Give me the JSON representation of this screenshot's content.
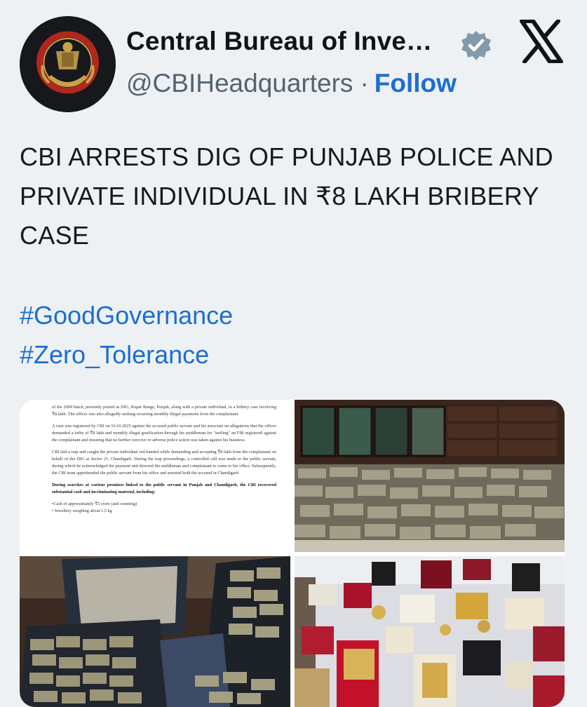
{
  "account": {
    "name": "Central Bureau of Inve…",
    "handle": "@CBIHeadquarters",
    "separator": "·",
    "follow_label": "Follow",
    "avatar_icon": "cbi-emblem-avatar",
    "verified_icon": "verified-badge-icon",
    "platform_icon": "x-logo-icon"
  },
  "tweet": {
    "text": "CBI ARRESTS DIG OF PUNJAB POLICE AND PRIVATE INDIVIDUAL IN ₹8 LAKH BRIBERY CASE",
    "hashtags": [
      "#GoodGovernance",
      "#Zero_Tolerance"
    ]
  },
  "media": {
    "document": {
      "paragraphs": [
        "of the 2009 batch, presently posted as DIG, Ropar Range, Punjab, along with a private individual, in a bribery case involving ₹8 lakh. The officer was also allegedly seeking recurring monthly illegal payments from the complainant.",
        "A case was registered by CBI on 16.10.2025 against the accused public servant and his associate on allegations that the officer demanded a bribe of ₹8 lakh and monthly illegal gratification through his middleman for \"settling\" an FIR registered against the complainant and ensuring that no further coercive or adverse police action was taken against his business.",
        "CBI laid a trap and caught the private individual red-handed while demanding and accepting ₹8 lakh from the complainant on behalf of the DIG at Sector 21, Chandigarh. During the trap proceedings, a controlled call was made to the public servant, during which he acknowledged the payment and directed the middleman and complainant to come to his office. Subsequently, the CBI team apprehended the public servant from his office and arrested both the accused in Chandigarh.",
        "During searches at various premises linked to the public servant in Punjab and Chandigarh, the CBI recovered substantial cash and incriminating material, including:",
        "•Cash of approximately ₹5 crore (and counting)",
        "• Jewellery weighing about 1.5 kg"
      ]
    },
    "photos": [
      "cash-bundles-on-floor-photo",
      "cash-in-bags-photo",
      "jewellery-on-table-photo"
    ]
  }
}
